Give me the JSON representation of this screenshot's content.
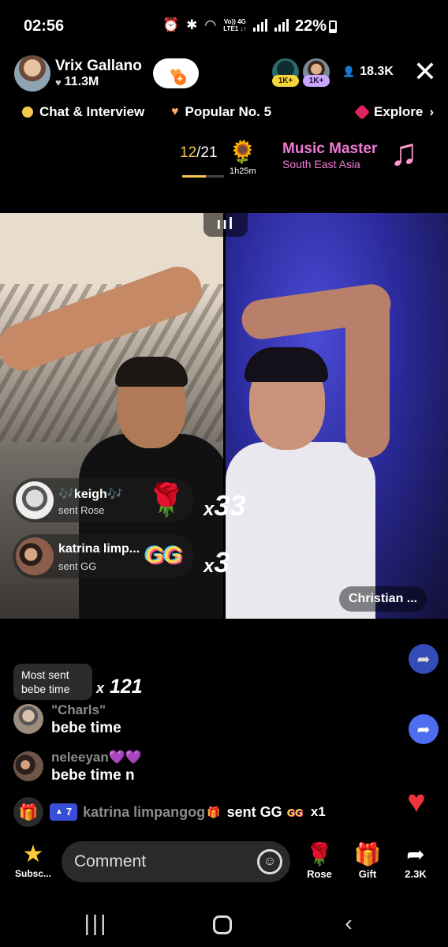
{
  "status_bar": {
    "time": "02:56",
    "net_top": "Vo)) 4G",
    "net_bottom": "LTE1 ↓↑",
    "battery": "22%"
  },
  "host": {
    "name": "Vrix Gallano",
    "likes": "11.3M",
    "icon": "heart-icon"
  },
  "viewers": {
    "badge1": "1K+",
    "badge2": "1K+",
    "count": "18.3K"
  },
  "tags": {
    "chat": "Chat & Interview",
    "popular": "Popular No. 5",
    "explore": "Explore"
  },
  "ranking": {
    "current": "12",
    "total": "/21",
    "progress": 0.57,
    "timer": "1h25m",
    "title": "Music Master",
    "region": "South East Asia"
  },
  "video": {
    "right_name": "Christian ..."
  },
  "gifts": [
    {
      "user": "🎶keigh🎶",
      "action": "sent Rose",
      "combo_prefix": "x",
      "combo": "33"
    },
    {
      "user": "katrina limp...",
      "action": "sent GG",
      "combo_prefix": "x",
      "combo": "3"
    }
  ],
  "most_sent": {
    "line1": "Most sent",
    "line2": "bebe time",
    "count_prefix": "x",
    "count": "121"
  },
  "chat": [
    {
      "name": "\"Charls\"",
      "message": "bebe time"
    },
    {
      "name": "neleeyan💜💜",
      "message": "bebe time n"
    }
  ],
  "gift_line": {
    "level": "7",
    "name": "katrina limpangog",
    "sent": "sent GG",
    "gift": "GG",
    "count": "x1"
  },
  "bottom_bar": {
    "subscribe": "Subsc...",
    "comment_placeholder": "Comment",
    "rose": "Rose",
    "gift": "Gift",
    "shares": "2.3K"
  },
  "colors": {
    "accent_yellow": "#f5c84a",
    "music_pink": "#f07ad6",
    "like_red": "#f0333e",
    "share_blue": "#3b5bd8"
  }
}
